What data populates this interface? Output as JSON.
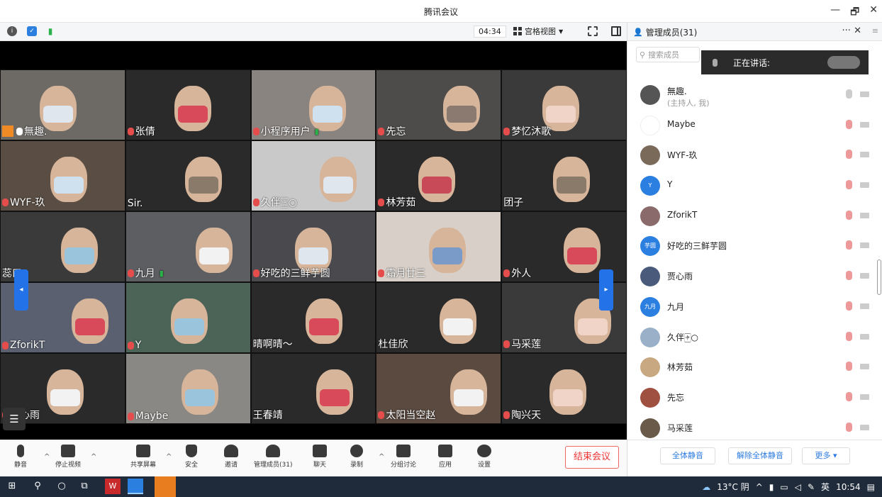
{
  "window": {
    "title": "腾讯会议",
    "controls": [
      "—",
      "🗗",
      "✕"
    ]
  },
  "toolbar": {
    "icons": [
      "info-icon",
      "shield-icon",
      "signal-icon"
    ],
    "timer": "04:34",
    "view_label": "宫格视图"
  },
  "tiles": [
    {
      "name": "無趣.",
      "mic": "on",
      "host": true
    },
    {
      "name": "张倩",
      "mic": "muted"
    },
    {
      "name": "小程序用户",
      "mic": "muted",
      "signal": true
    },
    {
      "name": "先忘",
      "mic": "muted"
    },
    {
      "name": "梦忆沐歌",
      "mic": "muted"
    },
    {
      "name": "WYF-玖",
      "mic": "muted"
    },
    {
      "name": "Sir.",
      "mic": "none"
    },
    {
      "name": "久伴🀄︎○",
      "mic": "muted"
    },
    {
      "name": "林芳茹",
      "mic": "muted"
    },
    {
      "name": "团子",
      "mic": "none"
    },
    {
      "name": "蕊口",
      "mic": "none"
    },
    {
      "name": "九月",
      "mic": "muted",
      "signal": true
    },
    {
      "name": "好吃的三鲜芋圆",
      "mic": "muted"
    },
    {
      "name": "霜月廿三",
      "mic": "muted"
    },
    {
      "name": "外人",
      "mic": "muted"
    },
    {
      "name": "ZforikT",
      "mic": "muted"
    },
    {
      "name": "Y",
      "mic": "muted"
    },
    {
      "name": "晴啊晴～",
      "mic": "none"
    },
    {
      "name": "杜佳欣",
      "mic": "none"
    },
    {
      "name": "马采莲",
      "mic": "muted"
    },
    {
      "name": "贾心雨",
      "mic": "muted"
    },
    {
      "name": "Maybe",
      "mic": "muted"
    },
    {
      "name": "王春靖",
      "mic": "none"
    },
    {
      "name": "太阳当空赵",
      "mic": "muted"
    },
    {
      "name": "陶兴天",
      "mic": "muted"
    }
  ],
  "bottom": {
    "mute": "静音",
    "stop_video": "停止视频",
    "share": "共享屏幕",
    "security": "安全",
    "invite": "邀请",
    "manage": "管理成员(31)",
    "chat": "聊天",
    "record": "录制",
    "breakout": "分组讨论",
    "apps": "应用",
    "settings": "设置",
    "end": "结束会议"
  },
  "panel": {
    "title": "管理成员(31)",
    "close": "✕",
    "more": "···",
    "search_placeholder": "搜索成员",
    "speaking": "正在讲话:",
    "participants": [
      {
        "name": "無趣.",
        "sub": "(主持人, 我)",
        "avatar": "",
        "color": "#555555",
        "mic": "on"
      },
      {
        "name": "Maybe",
        "avatar": "",
        "color": "#ffffff",
        "mic": "muted"
      },
      {
        "name": "WYF-玖",
        "avatar": "",
        "color": "#7a6a5a",
        "mic": "muted"
      },
      {
        "name": "Y",
        "avatar": "Y",
        "color": "#2b7fe0",
        "mic": "muted"
      },
      {
        "name": "ZforikT",
        "avatar": "",
        "color": "#8a6a6a",
        "mic": "muted"
      },
      {
        "name": "好吃的三鲜芋圆",
        "avatar": "芋圆",
        "color": "#2b7fe0",
        "mic": "muted"
      },
      {
        "name": "贾心雨",
        "avatar": "",
        "color": "#4a5a7a",
        "mic": "muted"
      },
      {
        "name": "九月",
        "avatar": "九月",
        "color": "#2b7fe0",
        "mic": "muted"
      },
      {
        "name": "久伴🀄︎○",
        "avatar": "",
        "color": "#9ab0c8",
        "mic": "muted"
      },
      {
        "name": "林芳茹",
        "avatar": "",
        "color": "#c8a880",
        "mic": "muted"
      },
      {
        "name": "先忘",
        "avatar": "",
        "color": "#a05040",
        "mic": "muted"
      },
      {
        "name": "马采莲",
        "avatar": "",
        "color": "#6a5a4a",
        "mic": "muted"
      }
    ],
    "mute_all": "全体静音",
    "unmute_all": "解除全体静音",
    "more_btn": "更多 ▾"
  },
  "taskbar": {
    "weather": "13°C 阴",
    "ime": "英",
    "time": "10:54"
  }
}
